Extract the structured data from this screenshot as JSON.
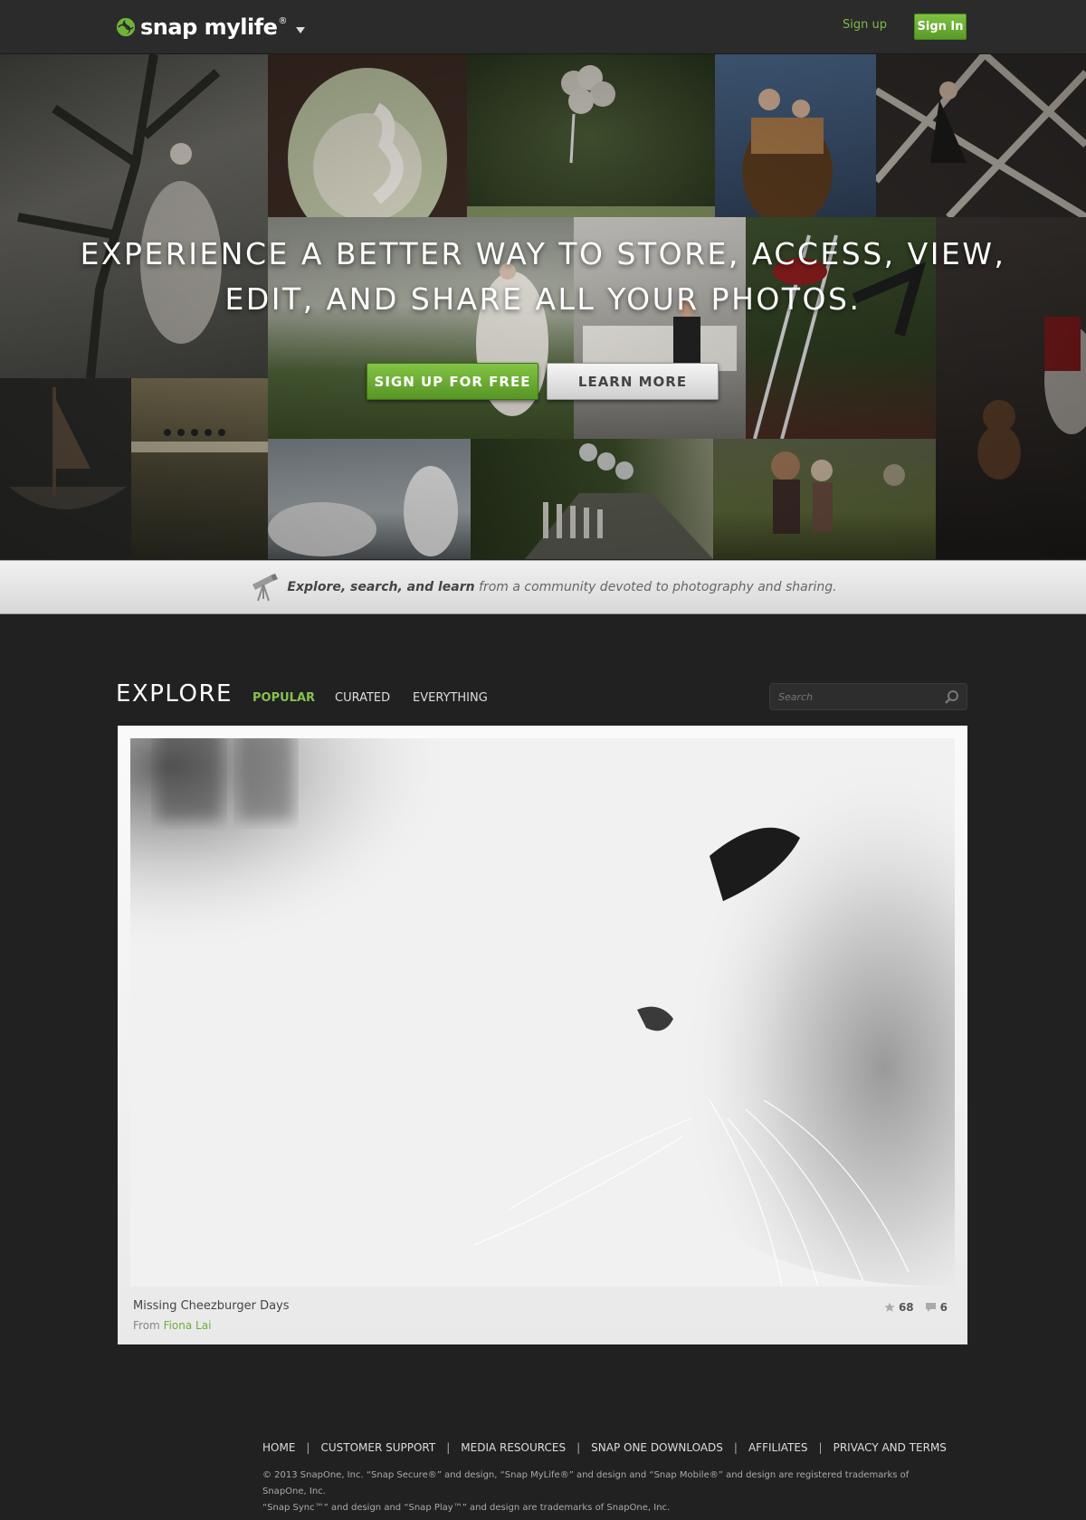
{
  "header": {
    "logo_text": "snap mylife",
    "logo_reg": "®",
    "signup_link": "Sign up",
    "signin_button": "Sign In"
  },
  "hero": {
    "headline_line1": "EXPERIENCE A BETTER WAY TO STORE, ACCESS, VIEW,",
    "headline_line2": "EDIT, AND SHARE ALL YOUR PHOTOS.",
    "signup_button": "SIGN UP FOR FREE",
    "learn_more_button": "LEARN MORE"
  },
  "banner": {
    "bold_text": "Explore, search, and learn",
    "rest_text": " from a community devoted to photography and sharing."
  },
  "explore": {
    "title": "EXPLORE",
    "tabs": [
      {
        "label": "POPULAR",
        "active": true
      },
      {
        "label": "CURATED",
        "active": false
      },
      {
        "label": "EVERYTHING",
        "active": false
      }
    ],
    "search_placeholder": "Search"
  },
  "featured": {
    "title": "Missing Cheezburger Days",
    "from_label": "From",
    "author": "Fiona Lai",
    "stars": "68",
    "comments": "6"
  },
  "footer": {
    "links": [
      "HOME",
      "CUSTOMER SUPPORT",
      "MEDIA RESOURCES",
      "SNAP ONE DOWNLOADS",
      "AFFILIATES",
      "PRIVACY AND TERMS"
    ],
    "separator": "|",
    "legal_line1": "© 2013 SnapOne, Inc. “Snap Secure®” and design, “Snap MyLife®” and design and “Snap Mobile®” and design are registered trademarks of SnapOne, Inc.",
    "legal_line2": "“Snap Sync™” and design and “Snap Play™” and design are trademarks of SnapOne, Inc."
  },
  "colors": {
    "brand_green": "#7dba45",
    "background": "#212121",
    "topbar": "#2b2b2b"
  }
}
